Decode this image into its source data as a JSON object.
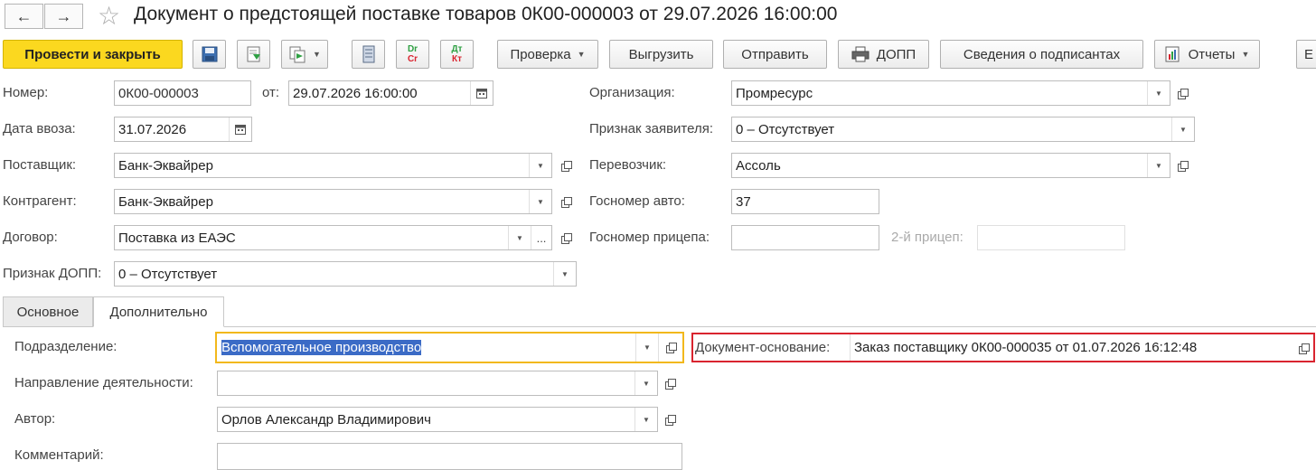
{
  "window": {
    "title": "Документ о предстоящей поставке товаров 0К00-000003 от 29.07.2026 16:00:00",
    "back_icon": "arrow-left-icon",
    "forward_icon": "arrow-right-icon",
    "favorite_icon": "star-icon"
  },
  "toolbar": {
    "post_close_label": "Провести и закрыть",
    "check_label": "Проверка",
    "export_label": "Выгрузить",
    "send_label": "Отправить",
    "dopp_label": "ДОПП",
    "signers_label": "Сведения о подписантах",
    "reports_label": "Отчеты",
    "dr_label": "Dr",
    "cr_label": "Cr",
    "dt_label": "Дт",
    "kt_label": "Кт",
    "more_label": "Е"
  },
  "form": {
    "number_label": "Номер:",
    "number_value": "0К00-000003",
    "from_label": "от:",
    "from_value": "29.07.2026 16:00:00",
    "import_date_label": "Дата ввоза:",
    "import_date_value": "31.07.2026",
    "supplier_label": "Поставщик:",
    "supplier_value": "Банк-Эквайрер",
    "counterparty_label": "Контрагент:",
    "counterparty_value": "Банк-Эквайрер",
    "contract_label": "Договор:",
    "contract_value": "Поставка из ЕАЭС",
    "dopp_sign_label": "Признак ДОПП:",
    "dopp_sign_value": "0 – Отсутствует",
    "organization_label": "Организация:",
    "organization_value": "Промресурс",
    "applicant_sign_label": "Признак заявителя:",
    "applicant_sign_value": "0 – Отсутствует",
    "carrier_label": "Перевозчик:",
    "carrier_value": "Ассоль",
    "car_plate_label": "Госномер авто:",
    "car_plate_value": "37",
    "trailer_plate_label": "Госномер прицепа:",
    "trailer_plate_value": "",
    "second_trailer_label": "2-й прицеп:",
    "second_trailer_value": ""
  },
  "tabs": [
    {
      "label": "Основное",
      "active": false
    },
    {
      "label": "Дополнительно",
      "active": true
    }
  ],
  "additional": {
    "department_label": "Подразделение:",
    "department_value": "Вспомогательное производство",
    "activity_label": "Направление деятельности:",
    "activity_value": "",
    "author_label": "Автор:",
    "author_value": "Орлов Александр Владимирович",
    "comment_label": "Комментарий:",
    "comment_value": "",
    "base_doc_label": "Документ-основание:",
    "base_doc_value": "Заказ поставщику 0К00-000035 от 01.07.2026 16:12:48"
  },
  "colors": {
    "primary_button": "#fbd81f",
    "focus_border": "#f2b81c",
    "highlight_border": "#d9242f",
    "selection_bg": "#3b6bc6"
  }
}
